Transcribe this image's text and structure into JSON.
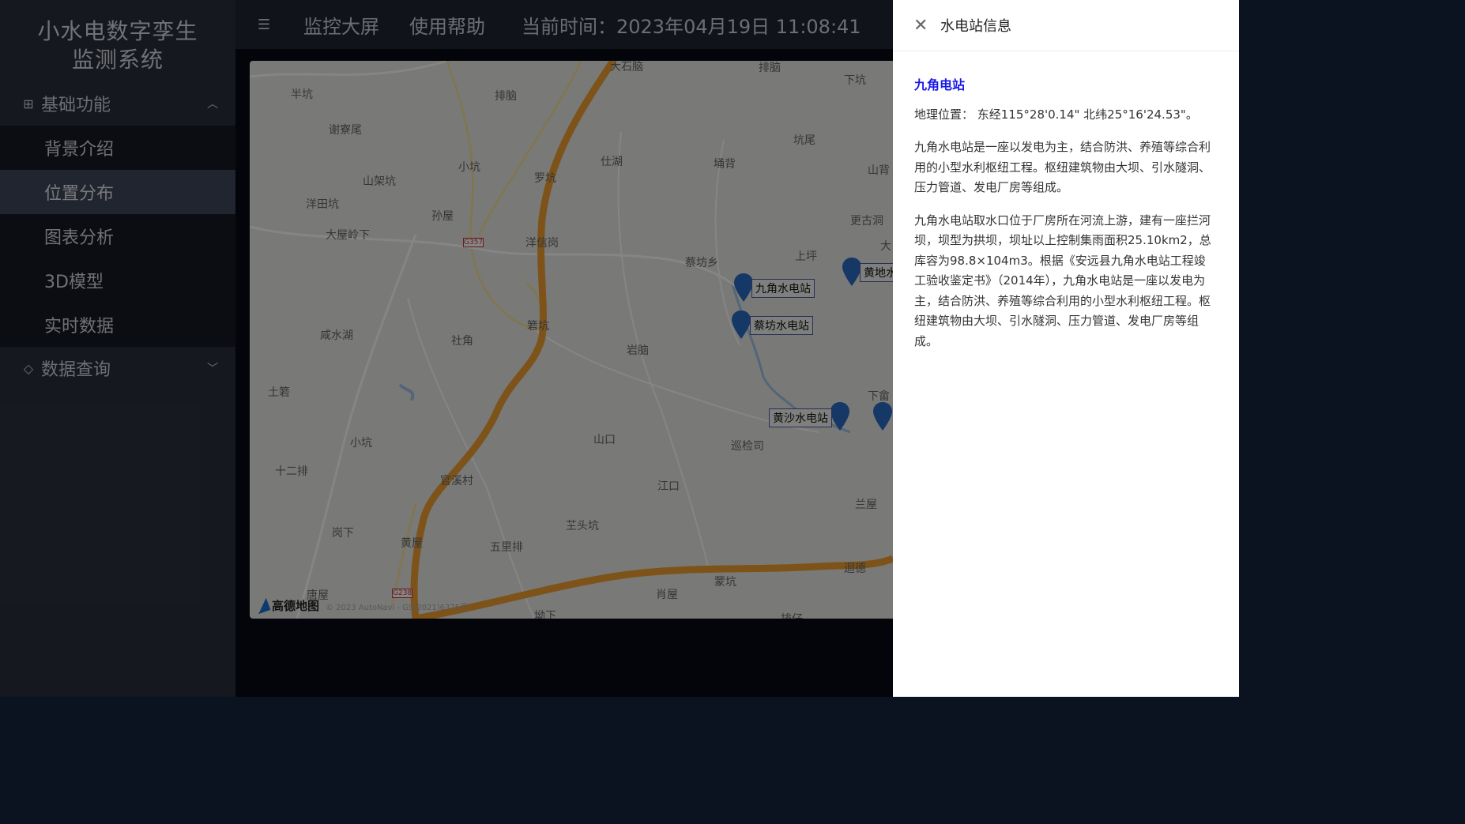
{
  "sidebar": {
    "brand_line1": "小水电数字孪生",
    "brand_line2": "监测系统",
    "group1_label": "基础功能",
    "items": [
      "背景介绍",
      "位置分布",
      "图表分析",
      "3D模型",
      "实时数据"
    ],
    "active_index": 1,
    "group2_label": "数据查询"
  },
  "header": {
    "monitor_label": "监控大屏",
    "help_label": "使用帮助",
    "time_text": "当前时间：2023年04月19日 11:08:41"
  },
  "map": {
    "places": [
      "大石脑",
      "排脑",
      "下坑",
      "半坑",
      "排脑",
      "谢寮尾",
      "小坑",
      "罗坑",
      "仕湖",
      "坑尾",
      "埇背",
      "山背",
      "山架坑",
      "洋田坑",
      "孙屋",
      "G357",
      "洋信岗",
      "更古洞",
      "大屋岭下",
      "蔡坊乡",
      "上坪",
      "大",
      "箬坑",
      "咸水湖",
      "社角",
      "岩脑",
      "土箬",
      "下畲",
      "小坑",
      "山口",
      "巡检司",
      "十二排",
      "官溪村",
      "江口",
      "兰屋",
      "岗下",
      "黄屋",
      "五里排",
      "芏头坑",
      "唐屋",
      "G238",
      "肖屋",
      "蒙坑",
      "迴德",
      "坳下",
      "排仔"
    ],
    "stations": [
      "九角水电站",
      "蔡坊水电站",
      "黄沙水电站",
      "黄地水"
    ],
    "logo_text": "高德地图",
    "copyright": "© 2023 AutoNavi - GS(2021)6375号"
  },
  "drawer": {
    "title": "水电站信息",
    "station_name": "九角电站",
    "location": "地理位置： 东经115°28'0.14\" 北纬25°16'24.53\"。",
    "para1": "九角水电站是一座以发电为主，结合防洪、养殖等综合利用的小型水利枢纽工程。枢纽建筑物由大坝、引水隧洞、压力管道、发电厂房等组成。",
    "para2": "九角水电站取水口位于厂房所在河流上游，建有一座拦河坝，坝型为拱坝，坝址以上控制集雨面积25.10km2，总库容为98.8×104m3。根据《安远县九角水电站工程竣工验收鉴定书》（2014年），九角水电站是一座以发电为主，结合防洪、养殖等综合利用的小型水利枢纽工程。枢纽建筑物由大坝、引水隧洞、压力管道、发电厂房等组成。"
  },
  "colors": {
    "sidebar_bg": "#2b2f3d",
    "active_item_bg": "#40485a",
    "station_name": "#1a1ae8",
    "marker": "#2b6cc4",
    "highway": "#f0a030"
  }
}
